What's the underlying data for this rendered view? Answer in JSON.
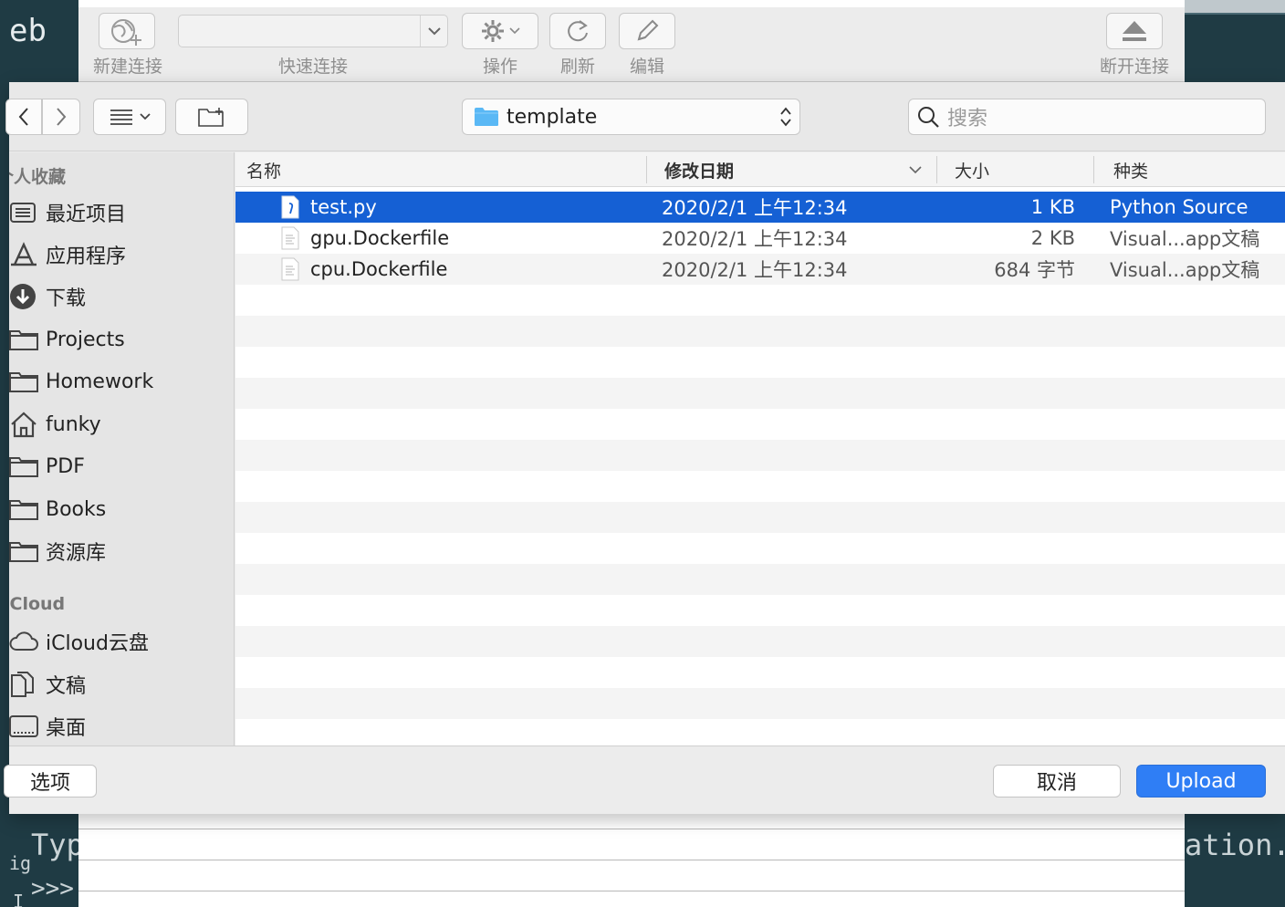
{
  "background_terminal": {
    "top_fragment": "eb",
    "lines": [
      "Typ",
      ">>>",
      "ation."
    ],
    "side_glyphs": [
      "ig",
      "I"
    ]
  },
  "app_toolbar": {
    "new_connection": "新建连接",
    "quick_connect": "快速连接",
    "action": "操作",
    "refresh": "刷新",
    "edit": "编辑",
    "disconnect": "断开连接"
  },
  "dialog": {
    "path": "template",
    "search_placeholder": "搜索"
  },
  "sidebar": {
    "favorites_header": "个人收藏",
    "favorites": [
      {
        "label": "最近项目",
        "icon": "recents-icon"
      },
      {
        "label": "应用程序",
        "icon": "applications-icon"
      },
      {
        "label": "下载",
        "icon": "download-icon"
      },
      {
        "label": "Projects",
        "icon": "folder-icon"
      },
      {
        "label": "Homework",
        "icon": "folder-icon"
      },
      {
        "label": "funky",
        "icon": "home-icon"
      },
      {
        "label": "PDF",
        "icon": "folder-icon"
      },
      {
        "label": "Books",
        "icon": "folder-icon"
      },
      {
        "label": "资源库",
        "icon": "folder-icon"
      }
    ],
    "icloud_header": "iCloud",
    "icloud": [
      {
        "label": "iCloud云盘",
        "icon": "cloud-icon"
      },
      {
        "label": "文稿",
        "icon": "documents-icon"
      },
      {
        "label": "桌面",
        "icon": "desktop-icon"
      }
    ]
  },
  "file_list": {
    "columns": {
      "name": "名称",
      "modified": "修改日期",
      "size": "大小",
      "kind": "种类"
    },
    "rows": [
      {
        "name": "test.py",
        "modified": "2020/2/1 上午12:34",
        "size": "1 KB",
        "kind": "Python Source",
        "selected": true
      },
      {
        "name": "gpu.Dockerfile",
        "modified": "2020/2/1 上午12:34",
        "size": "2 KB",
        "kind": "Visual...app文稿",
        "selected": false
      },
      {
        "name": "cpu.Dockerfile",
        "modified": "2020/2/1 上午12:34",
        "size": "684 字节",
        "kind": "Visual...app文稿",
        "selected": false
      }
    ]
  },
  "footer": {
    "options": "选项",
    "cancel": "取消",
    "upload": "Upload"
  },
  "colors": {
    "selection": "#1560d4",
    "primary_button": "#2f7ef5",
    "terminal_bg": "#1f3b44",
    "folder_blue": "#5ab8f5"
  }
}
